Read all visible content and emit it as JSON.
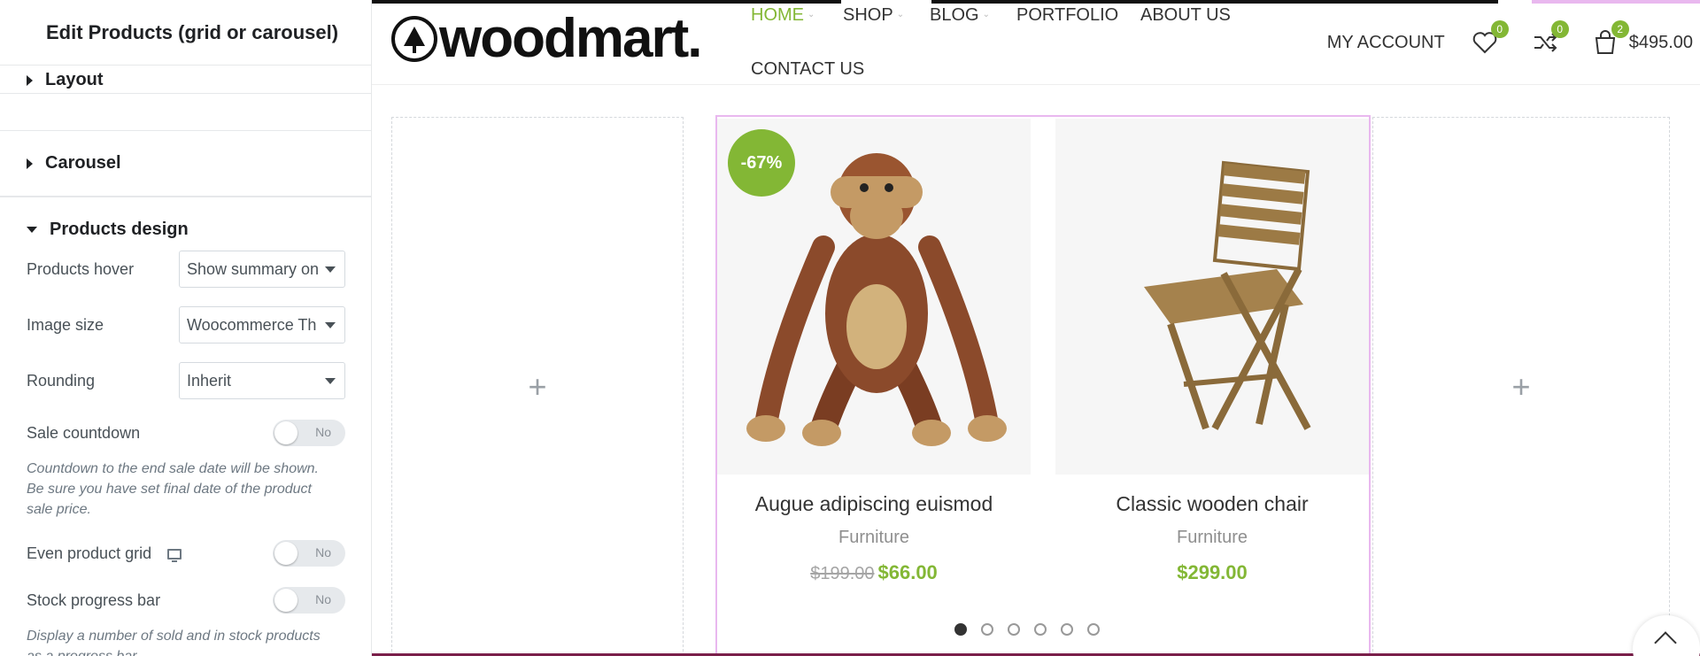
{
  "editor": {
    "title": "Edit Products (grid or carousel)",
    "sections": {
      "layout": "Layout",
      "carousel": "Carousel",
      "products_design": "Products design"
    },
    "controls": {
      "products_hover_label": "Products hover",
      "products_hover_value": "Show summary on",
      "image_size_label": "Image size",
      "image_size_value": "Woocommerce Th",
      "rounding_label": "Rounding",
      "rounding_value": "Inherit",
      "sale_countdown_label": "Sale countdown",
      "sale_countdown_value": "No",
      "sale_countdown_note": "Countdown to the end sale date will be shown. Be sure you have set final date of the product sale price.",
      "even_grid_label": "Even product grid",
      "even_grid_value": "No",
      "stock_bar_label": "Stock progress bar",
      "stock_bar_value": "No",
      "stock_bar_note": "Display a number of sold and in stock products as a progress bar."
    },
    "collapse_glyph": "‹"
  },
  "site": {
    "logo_text": "woodmart.",
    "nav": {
      "home": "HOME",
      "shop": "SHOP",
      "blog": "BLOG",
      "portfolio": "PORTFOLIO",
      "about": "ABOUT US",
      "contact": "CONTACT US"
    },
    "my_account": "MY ACCOUNT",
    "wishlist_count": "0",
    "compare_count": "0",
    "cart_count": "2",
    "cart_total": "$495.00",
    "add_glyph": "+",
    "products": [
      {
        "badge": "-67%",
        "title": "Augue adipiscing euismod",
        "category": "Furniture",
        "old_price": "$199.00",
        "price": "$66.00"
      },
      {
        "title": "Classic wooden chair",
        "category": "Furniture",
        "price": "$299.00"
      }
    ],
    "pagination_dots": 6,
    "active_dot": 1
  },
  "colors": {
    "accent": "#83b735",
    "selection": "#e9b8ef"
  }
}
